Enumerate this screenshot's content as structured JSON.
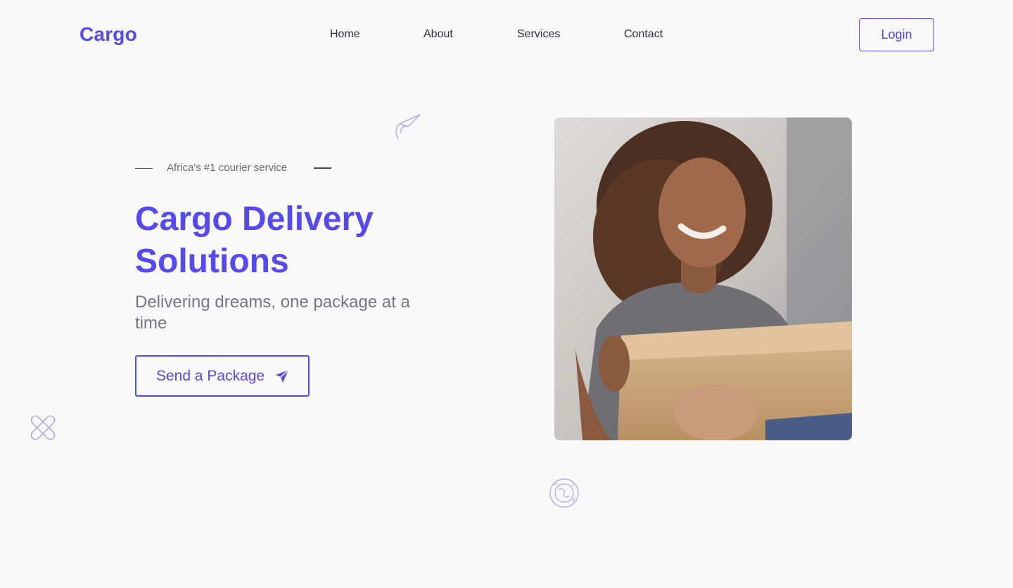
{
  "header": {
    "logo": "Cargo",
    "nav": [
      "Home",
      "About",
      "Services",
      "Contact"
    ],
    "login_label": "Login"
  },
  "hero": {
    "tagline": "Africa's #1 courier service",
    "title": "Cargo Delivery Solutions",
    "subtitle": "Delivering dreams, one package at a time",
    "cta_label": "Send a Package",
    "cta_icon": "paper-plane-icon",
    "image": "woman-receiving-package-photo"
  },
  "decorations": [
    "paper-plane-outline-icon",
    "bandage-cross-outline-icon",
    "globe-outline-icon"
  ],
  "colors": {
    "accent": "#5548f5",
    "text": "#2e2e3a",
    "muted": "#76767f",
    "background": "#f9f9fa"
  }
}
